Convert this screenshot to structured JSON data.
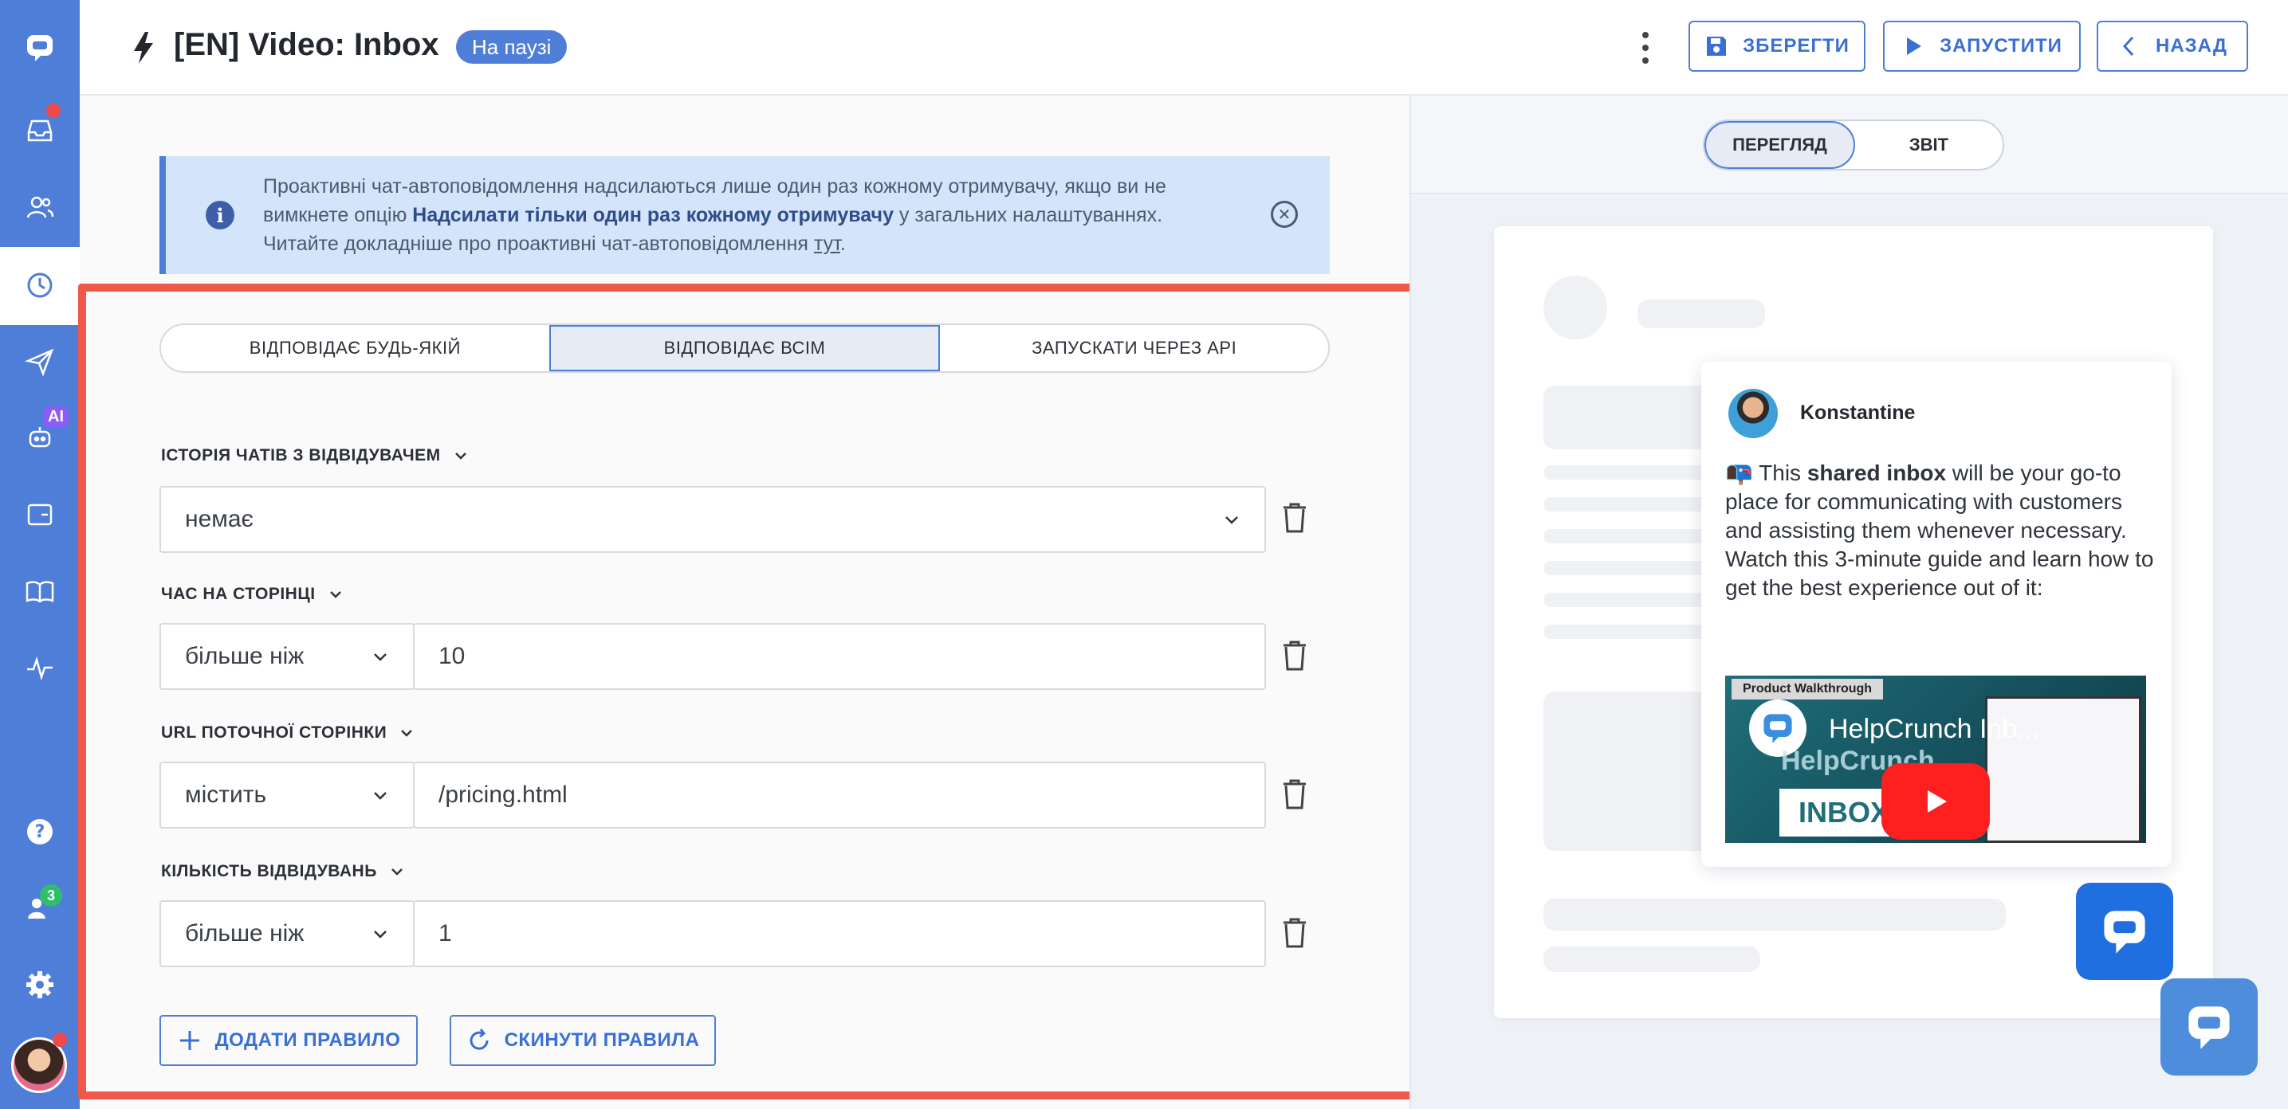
{
  "header": {
    "title": "[EN] Video: Inbox",
    "status": "На паузі",
    "save_label": "ЗБЕРЕГТИ",
    "run_label": "ЗАПУСТИТИ",
    "back_label": "НАЗАД"
  },
  "notice": {
    "text_1": "Проактивні чат-автоповідомлення надсилаються лише один раз кожному отримувачу, якщо ви не вимкнете опцію ",
    "text_bold": "Надсилати тільки один раз кожному отримувачу",
    "text_2": " у загальних налаштуваннях. Читайте докладніше про проактивні чат-автоповідомлення ",
    "link": "тут",
    "text_end": "."
  },
  "match": {
    "options": [
      "ВІДПОВІДАЄ БУДЬ-ЯКІЙ",
      "ВІДПОВІДАЄ ВСІМ",
      "ЗАПУСКАТИ ЧЕРЕЗ API"
    ],
    "selected": "ВІДПОВІДАЄ ВСІМ"
  },
  "rules": [
    {
      "label": "ІСТОРІЯ ЧАТІВ З ВІДВІДУВАЧЕМ",
      "value": "немає"
    },
    {
      "label": "ЧАС НА СТОРІНЦІ",
      "operator": "більше ніж",
      "value": "10"
    },
    {
      "label": "URL ПОТОЧНОЇ СТОРІНКИ",
      "operator": "містить",
      "value": "/pricing.html"
    },
    {
      "label": "КІЛЬКІСТЬ ВІДВІДУВАНЬ",
      "operator": "більше ніж",
      "value": "1"
    }
  ],
  "actions": {
    "add_rule": "ДОДАТИ ПРАВИЛО",
    "reset_rules": "СКИНУТИ ПРАВИЛА"
  },
  "preview": {
    "tabs": [
      "ПЕРЕГЛЯД",
      "ЗВІТ"
    ],
    "selected": "ПЕРЕГЛЯД",
    "sender": "Konstantine",
    "msg_emoji": "📭",
    "msg_1": " This ",
    "msg_bold": "shared inbox",
    "msg_2": " will be your go-to place for communicating with customers and assisting them whenever necessary. Watch this 3-minute guide and learn how to get the best experience out of it:",
    "video": {
      "tag": "Product Walkthrough",
      "title": "HelpCrunch Inb...",
      "overlay_brand": "HelpCrunch",
      "overlay_word": "INBOX"
    }
  },
  "sidebar": {
    "ai_badge": "AI",
    "team_count": "3"
  },
  "colors": {
    "brand": "#4f7ed9",
    "highlight_frame": "#f0584a",
    "notice_bg": "#d3e4fb"
  }
}
